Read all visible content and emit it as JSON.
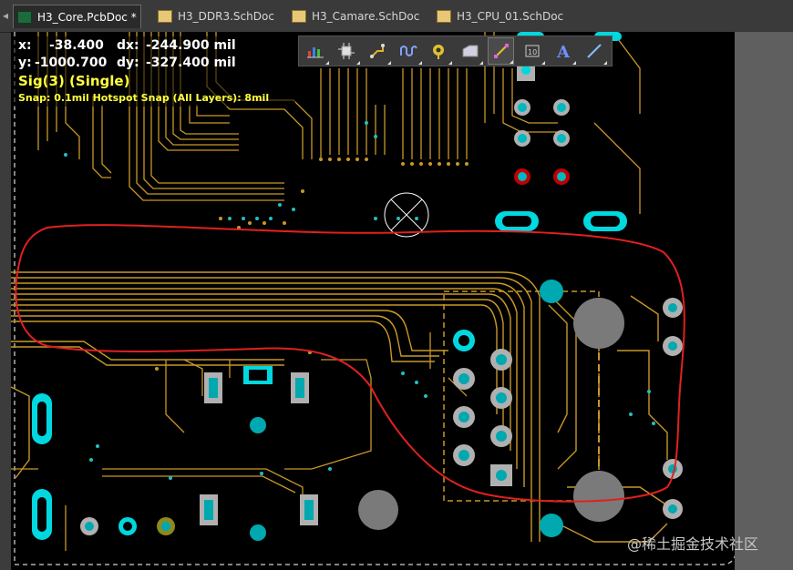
{
  "tabs": [
    {
      "label": "H3_Core.PcbDoc *",
      "type": "pcb",
      "active": true
    },
    {
      "label": "H3_DDR3.SchDoc",
      "type": "sch",
      "active": false
    },
    {
      "label": "H3_Camare.SchDoc",
      "type": "sch",
      "active": false
    },
    {
      "label": "H3_CPU_01.SchDoc",
      "type": "sch",
      "active": false
    }
  ],
  "hud": {
    "x_label": "x:",
    "x_value": "-38.400",
    "dx_label": "dx:",
    "dx_value": "-244.900 mil",
    "y_label": "y:",
    "y_value": "-1000.700",
    "dy_label": "dy:",
    "dy_value": "-327.400  mil",
    "net": "Sig(3) (Single)",
    "snap": "Snap: 0.1mil Hotspot Snap (All Layers): 8mil"
  },
  "toolbar": {
    "tools": [
      "filter-chart-icon",
      "component-icon",
      "route-icon",
      "interactive-route-icon",
      "via-icon",
      "polygon-icon",
      "dimension-icon",
      "text-frame-icon",
      "string-text-icon",
      "line-icon"
    ]
  },
  "watermark": "@稀土掘金技术社区",
  "colors": {
    "trace": "#c89828",
    "pad_cyan": "#00d8e0",
    "pad_gray": "#9a9a9a",
    "highlight": "#e02020",
    "hud_text": "#ffff3c",
    "board_bg": "#000000"
  }
}
